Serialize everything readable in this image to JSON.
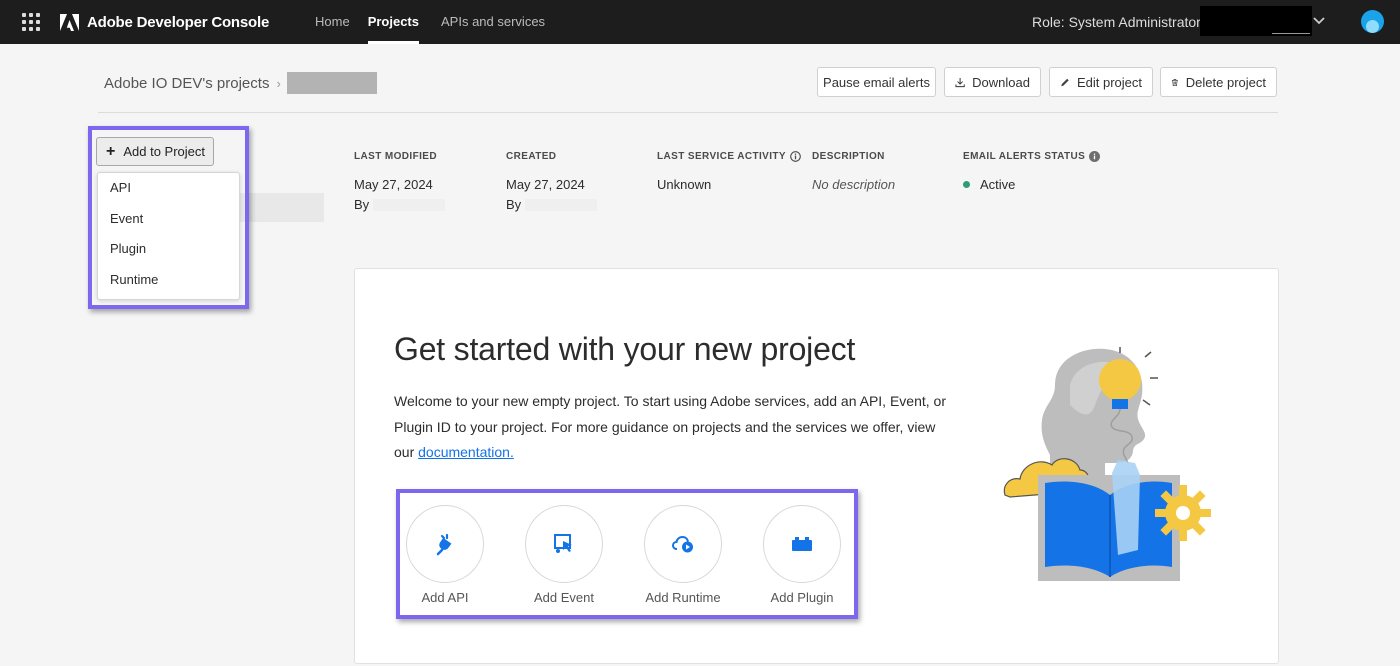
{
  "topbar": {
    "brand": "Adobe Developer Console",
    "nav": [
      {
        "label": "Home",
        "active": false
      },
      {
        "label": "Projects",
        "active": true
      },
      {
        "label": "APIs and services",
        "active": false
      }
    ],
    "role": "Role: System Administrator",
    "icons": [
      "app-switcher-icon",
      "adobe-logo-icon",
      "chevron-down-icon",
      "user-avatar-icon"
    ]
  },
  "breadcrumb": {
    "root": "Adobe IO DEV's projects",
    "separator": "›"
  },
  "actions": {
    "pause": "Pause email alerts",
    "download": "Download",
    "edit": "Edit project",
    "delete": "Delete project"
  },
  "add_menu": {
    "button": "Add to Project",
    "items": [
      "API",
      "Event",
      "Plugin",
      "Runtime"
    ]
  },
  "meta": {
    "last_modified": {
      "label": "LAST MODIFIED",
      "date": "May 27, 2024",
      "by": "By"
    },
    "created": {
      "label": "CREATED",
      "date": "May 27, 2024",
      "by": "By"
    },
    "last_activity": {
      "label": "LAST SERVICE ACTIVITY",
      "value": "Unknown"
    },
    "description": {
      "label": "DESCRIPTION",
      "value": "No description"
    },
    "email_status": {
      "label": "EMAIL ALERTS STATUS",
      "value": "Active",
      "color": "#2d9d78"
    }
  },
  "card": {
    "title": "Get started with your new project",
    "desc_pre": "Welcome to your new empty project. To start using Adobe services, add an API, Event, or Plugin ID to your project. For more guidance on projects and the services we offer, view our ",
    "link": "documentation."
  },
  "tiles": [
    {
      "label": "Add API",
      "icon": "plug-icon"
    },
    {
      "label": "Add Event",
      "icon": "event-icon"
    },
    {
      "label": "Add Runtime",
      "icon": "cloud-play-icon"
    },
    {
      "label": "Add Plugin",
      "icon": "plugin-brick-icon"
    }
  ],
  "colors": {
    "topbar": "#1d1d1d",
    "accent_blue": "#1473e6",
    "highlight": "#7b68ee",
    "status_green": "#2d9d78"
  }
}
